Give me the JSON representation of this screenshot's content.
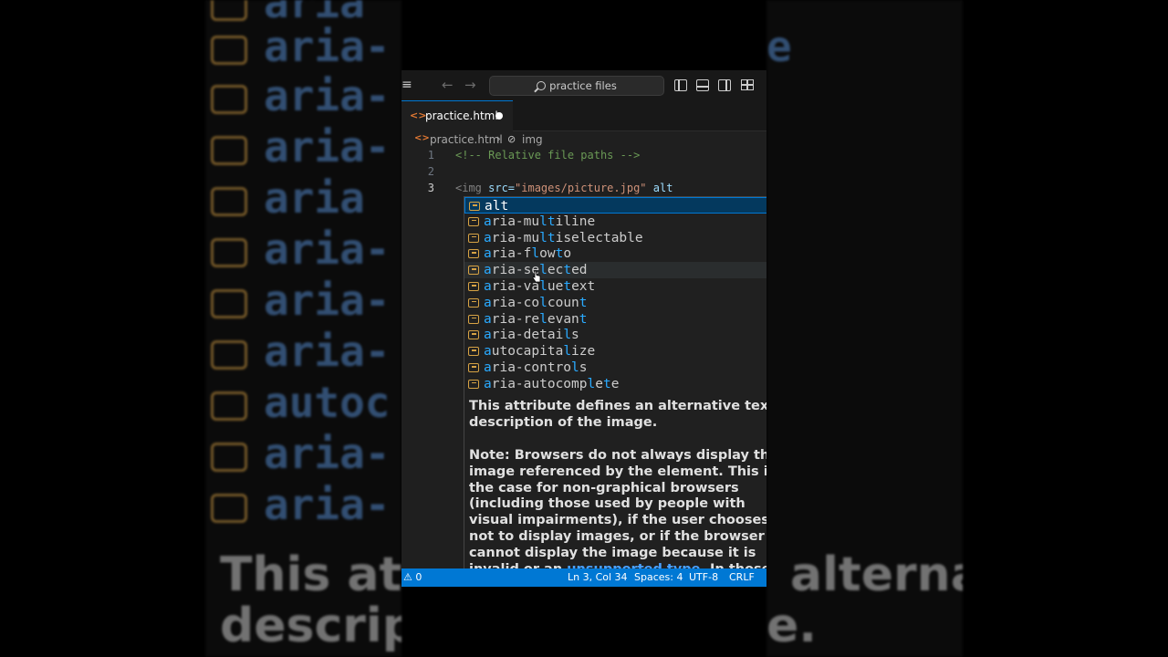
{
  "titlebar": {
    "search_text": "practice files"
  },
  "tab": {
    "label": "practice.html"
  },
  "breadcrumb": {
    "file": "practice.html",
    "element": "img"
  },
  "code": {
    "lines": [
      {
        "number": "1",
        "text": "<!-- Relative file paths -->"
      },
      {
        "number": "2",
        "text": ""
      },
      {
        "number": "3",
        "tag_open": "<img",
        "attr1": " src=",
        "value1": "\"images/picture.jpg\"",
        "attr2": " alt"
      }
    ]
  },
  "suggestions": [
    {
      "label": "alt",
      "selected": true
    },
    {
      "label": "aria-multiline"
    },
    {
      "label": "aria-multiselectable"
    },
    {
      "label": "aria-flowto"
    },
    {
      "label": "aria-selected",
      "hover": true
    },
    {
      "label": "aria-valuetext"
    },
    {
      "label": "aria-colcount"
    },
    {
      "label": "aria-relevant"
    },
    {
      "label": "aria-details"
    },
    {
      "label": "autocapitalize"
    },
    {
      "label": "aria-controls"
    },
    {
      "label": "aria-autocomplete"
    }
  ],
  "details": {
    "summary": "This attribute defines an alternative text description of the image.",
    "note": "Note: Browsers do not always display the image referenced by the element. This is the case for non-graphical browsers (including those used by people with visual impairments), if the user chooses not to display images, or if the browser cannot display the image because it is invalid or an",
    "link_text": "unsupported type",
    "note_tail": ". In those cases, the browser"
  },
  "statusbar": {
    "problems": "⚠ 0",
    "position": "Ln 3, Col 34",
    "spaces": "Spaces: 4",
    "encoding": "UTF-8",
    "eol": "CRLF"
  },
  "background": {
    "rows_left": [
      "aria",
      "aria-",
      "aria-",
      "aria-",
      "aria",
      "aria-",
      "aria-",
      "aria-",
      "autoc",
      "aria-",
      "aria-"
    ],
    "rows_right": [
      "e",
      "e",
      "",
      "",
      "",
      "",
      "",
      "",
      "",
      "",
      ""
    ],
    "caption_line1_left": "This attr",
    "caption_line1_right": "alternative text",
    "caption_line2_left": "descript",
    "caption_line2_right": "e."
  },
  "colors": {
    "accent": "#0078d4",
    "editor_bg": "#1f1f1f",
    "comment": "#6a9955",
    "tag": "#3c9bd6",
    "string": "#ce9178",
    "match": "#2aaaff"
  }
}
